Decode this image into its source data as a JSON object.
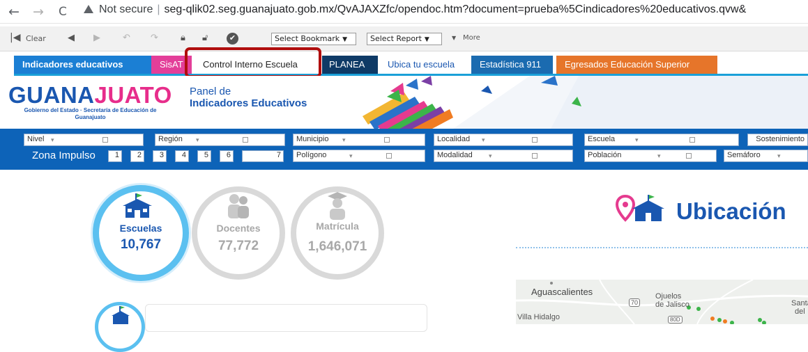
{
  "browser": {
    "back": "←",
    "forward": "→",
    "reload": "C",
    "security": "Not secure",
    "url": "seg-qlik02.seg.guanajuato.gob.mx/QvAJAXZfc/opendoc.htm?document=prueba%5Cindicadores%20educativos.qvw&"
  },
  "toolbar": {
    "clear": "Clear",
    "bookmark_select": "Select Bookmark",
    "report_select": "Select Report",
    "more": "More"
  },
  "tabs": [
    {
      "label": "Indicadores educativos",
      "bg": "#1b7fd4",
      "fg": "#ffffff",
      "bold": true
    },
    {
      "label": "SisAT",
      "bg": "#e33e99",
      "fg": "#ffffff"
    },
    {
      "label": "Control Interno Escuela",
      "bg": "#ffffff",
      "fg": "#222222"
    },
    {
      "label": "PLANEA",
      "bg": "#0e3a66",
      "fg": "#ffffff"
    },
    {
      "label": "Ubica tu escuela",
      "bg": "#ffffff",
      "fg": "#1a57b0"
    },
    {
      "label": "Estadística 911",
      "bg": "#1b6bb0",
      "fg": "#ffffff"
    },
    {
      "label": "Egresados Educación Superior",
      "bg": "#e6752a",
      "fg": "#ffffff"
    }
  ],
  "header": {
    "logo_main_a": "GUANA",
    "logo_main_b": "JUATO",
    "logo_sub": "Gobierno del Estado  ·  Secretaría de Educación de Guanajuato",
    "panel_line1": "Panel de",
    "panel_line2": "Indicadores Educativos"
  },
  "filters": {
    "row1": [
      "Nivel",
      "Región",
      "Municipio",
      "Localidad",
      "Escuela",
      "Sostenimiento"
    ],
    "row2": [
      "Polígono",
      "Modalidad",
      "Población",
      "Semáforo"
    ],
    "zona_label": "Zona Impulso",
    "zona_numbers": [
      "1",
      "2",
      "3",
      "4",
      "5",
      "6",
      "7"
    ]
  },
  "kpis": [
    {
      "label": "Escuelas",
      "value": "10,767",
      "active": true
    },
    {
      "label": "Docentes",
      "value": "77,772",
      "active": false
    },
    {
      "label": "Matrícula",
      "value": "1,646,071",
      "active": false
    }
  ],
  "ubicacion": {
    "title": "Ubicación"
  },
  "map": {
    "labels": [
      "Aguascalientes",
      "Ojuelos de Jalisco",
      "Villa Hidalgo",
      "Santa",
      "del"
    ],
    "road_70": "70",
    "road_80d": "80D"
  },
  "colors": {
    "primary_blue": "#1a57b0",
    "filter_blue": "#0d63b8",
    "highlight_red": "#b00d0d",
    "kpi_active_ring": "#5bc0f0",
    "kpi_inactive_ring": "#d9d9d9"
  }
}
